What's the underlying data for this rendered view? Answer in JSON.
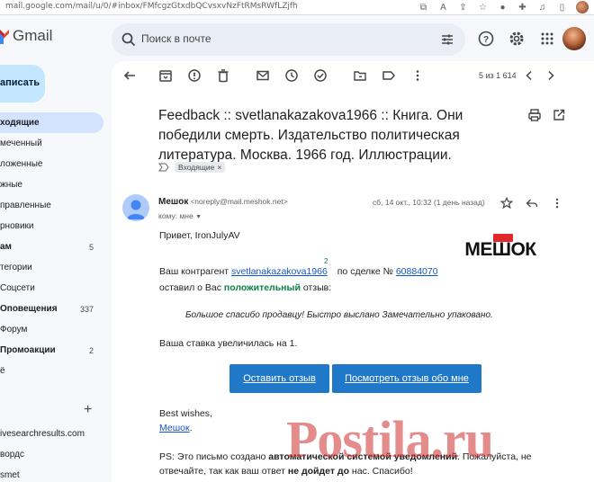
{
  "browser": {
    "url": "mail.google.com/mail/u/0/#inbox/FMfcgzGtxdbQCvsxvNzFtRMsRWfLZjfh"
  },
  "header": {
    "app_name": "Gmail",
    "search_placeholder": "Поиск в почте"
  },
  "sidebar": {
    "compose_label": "аписать",
    "items": [
      {
        "label": "ходящие",
        "count": ""
      },
      {
        "label": "меченный",
        "count": ""
      },
      {
        "label": "ложенные",
        "count": ""
      },
      {
        "label": "жные",
        "count": ""
      },
      {
        "label": "правленные",
        "count": ""
      },
      {
        "label": "рновики",
        "count": ""
      },
      {
        "label": "ам",
        "count": "5"
      },
      {
        "label": "тегории",
        "count": ""
      },
      {
        "label": "Соцсети",
        "count": ""
      },
      {
        "label": "Оповещения",
        "count": "337"
      },
      {
        "label": "Форум",
        "count": ""
      },
      {
        "label": "Промоакции",
        "count": "2"
      },
      {
        "label": "ё",
        "count": ""
      }
    ],
    "labels": [
      "ivesearchresults.com",
      "вордс",
      "smet"
    ]
  },
  "toolbar": {
    "pager": "5 из 1 614"
  },
  "email": {
    "subject": "Feedback :: svetlanakazakova1966 :: Книга. Они победили смерть. Издательство политическая литература. Москва. 1966 год. Иллюстрации.",
    "label_chip": "Входящие",
    "label_chip_close": "×",
    "sender_name": "Мешок",
    "sender_email": "<noreply@mail.meshok.net>",
    "to_line": "кому: мне",
    "date": "сб, 14 окт., 10:32 (1 день назад)",
    "greeting": "Привет, IronJulyAV",
    "logo_text": "МЕШОК",
    "contact_prefix": "Ваш контрагент ",
    "contact_name": "svetlanakazakova1966",
    "contact_rating": "2",
    "deal_text": " по сделке № ",
    "deal_number": "60884070",
    "left_prefix": "оставил о Вас ",
    "left_rating": "положительный",
    "left_suffix": " отзыв:",
    "quote": "Большое спасибо продавцу! Быстро выслано Замечательно упаковано.",
    "bid_text": "Ваша ставка увеличилась на 1.",
    "button_leave": "Оставить отзыв",
    "button_view": "Посмотреть отзыв обо мне",
    "closing": "Best wishes,",
    "signature": "Мешок",
    "signature_dot": ".",
    "ps_prefix": "PS: Это письмо создано ",
    "ps_bold": "автоматической системой уведомлений",
    "ps_suffix": ". Пожалуйста, не",
    "ps2_prefix": "отвечайте, так как ваш ответ ",
    "ps2_bold": "не дойдет до",
    "ps2_suffix": " нас. Спасибо!"
  },
  "watermark": {
    "text": "Postila.ru"
  }
}
